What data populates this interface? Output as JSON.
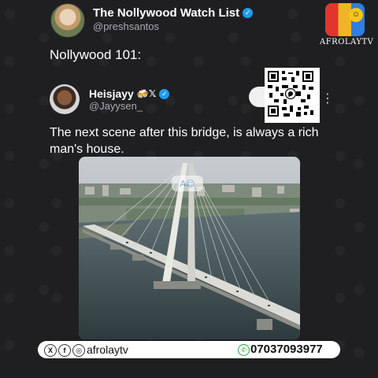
{
  "post": {
    "author_name": "The Nollywood Watch List",
    "author_handle": "@preshsantos",
    "text": "Nollywood 101:"
  },
  "quoted_post": {
    "author_name": "Heisjayy",
    "name_badges": "🍻𝕏",
    "author_handle": "@Jayysen_",
    "text": "The next scene after this bridge, is always a rich man's house."
  },
  "logo": {
    "text": "AFROLAYTV"
  },
  "footer": {
    "social_icons": [
      "x-icon",
      "facebook-icon",
      "instagram-icon"
    ],
    "handle": "afrolaytv",
    "phone": "07037093977"
  },
  "colors": {
    "background": "#1f1f22",
    "verified": "#1d9bf0",
    "handle_gray": "#a9a9b0"
  },
  "icons": {
    "verified": "verified-badge-icon",
    "more": "more-options-icon",
    "qr": "qr-code-icon",
    "whatsapp": "whatsapp-icon"
  }
}
